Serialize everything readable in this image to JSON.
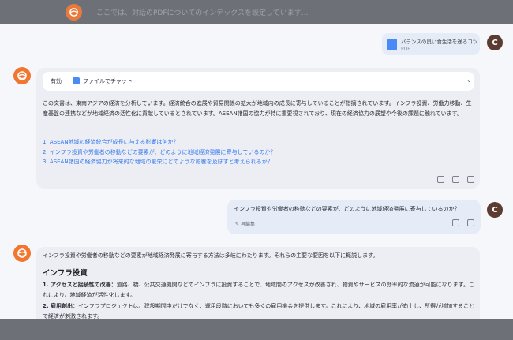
{
  "topbar": {
    "text": "ここでは、対話のPDFについてのインデックスを設定しています..."
  },
  "file_attachment": {
    "name": "バランスの良い食生活を送るコツ...",
    "type": "PDF"
  },
  "user": {
    "avatar_letter": "C"
  },
  "first_response": {
    "card_status": "有効",
    "card_label": "ファイルでチャット",
    "summary": "この文書は、東南アジアの経済を分析しています。経済統合の進展や貿易関係の拡大が地域内の成長に寄与していることが指摘されています。インフラ投資、労働力移動、生産基盤の連携などが地域経済の活性化に貢献しているとされています。ASEAN諸国の協力が特に重要視されており、現在の経済協力の展望や今後の課題に触れています。",
    "questions": [
      "1.  ASEAN地域の経済統合が成長に与える影響は何か？",
      "2.  インフラ投資や労働者の移動などの要素が、どのように地域経済発展に寄与しているのか？",
      "3.  ASEAN諸国の経済協力が将来的な地域の繁栄にどのような影響を及ぼすと考えられるか？"
    ]
  },
  "user_question": {
    "text": "インフラ投資や労働者の移動などの要素が、どのように地域経済発展に寄与しているのか？",
    "edit_label": "再編集"
  },
  "answer": {
    "intro": "インフラ投資や労働者の移動などの要素が地域経済発展に寄与する方法は多岐にわたります。それらの主要な要因を以下に概説します。",
    "heading": "インフラ投資",
    "items": [
      {
        "title": "1.  アクセスと接続性の改善：",
        "body": "道路、橋、公共交通機関などのインフラに投資することで、地域間のアクセスが改善され、物資やサービスの効率的な流通が可能になります。これにより、地域経済が活性化します。"
      },
      {
        "title": "2.  雇用創出：",
        "body": "インフラプロジェクトは、建設期間中だけでなく、運用段階においても多くの雇用機会を提供します。これにより、地域の雇用率が向上し、所得が増加することで経済が刺激されます。"
      }
    ]
  }
}
